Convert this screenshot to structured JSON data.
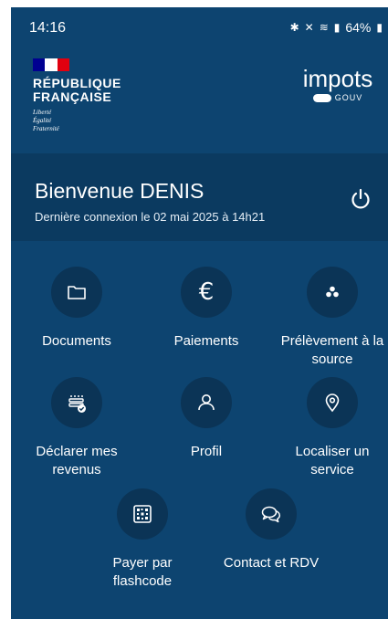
{
  "statusbar": {
    "time": "14:16",
    "battery": "64%"
  },
  "header": {
    "republic_line1": "RÉPUBLIQUE",
    "republic_line2": "FRANÇAISE",
    "motto": [
      "Liberté",
      "Égalité",
      "Fraternité"
    ],
    "brand": "impots",
    "brand_sub": "GOUV",
    "flag_colors": [
      "#000091",
      "#ffffff",
      "#e1000f"
    ]
  },
  "welcome": {
    "title": "Bienvenue DENIS",
    "last_login": "Dernière connexion le 02 mai 2025 à 14h21"
  },
  "colors": {
    "background": "#0d4470",
    "welcome_band": "#0b3a60",
    "icon_circle": "#0b3456"
  },
  "menu": [
    {
      "label": "Documents",
      "icon": "folder-icon"
    },
    {
      "label": "Paiements",
      "icon": "euro-icon"
    },
    {
      "label": "Prélèvement à la source",
      "icon": "dots-icon"
    },
    {
      "label": "Déclarer mes revenus",
      "icon": "declaration-icon"
    },
    {
      "label": "Profil",
      "icon": "person-icon"
    },
    {
      "label": "Localiser un service",
      "icon": "location-pin-icon"
    },
    {
      "label": "Payer par flashcode",
      "icon": "qr-code-icon"
    },
    {
      "label": "Contact et RDV",
      "icon": "chat-bubbles-icon"
    }
  ]
}
